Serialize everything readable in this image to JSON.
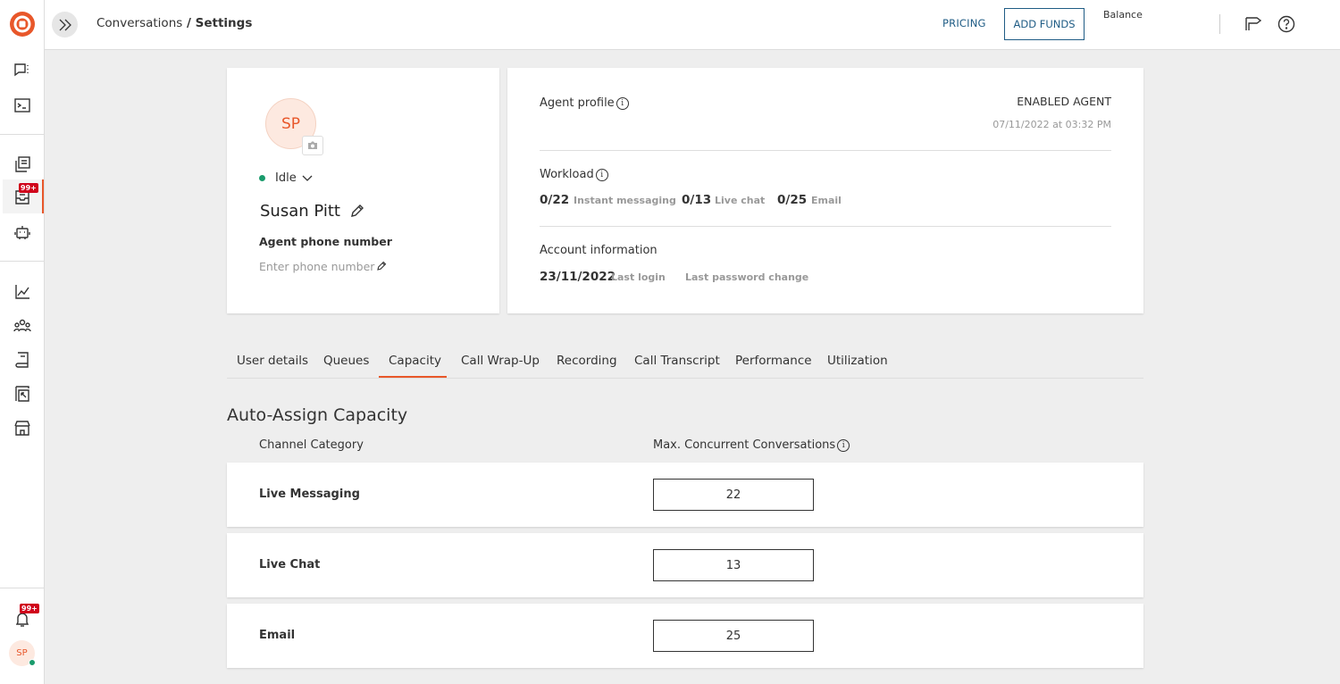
{
  "sidebar": {
    "notifications_badge": "99+",
    "inbox_badge": "99+",
    "avatar_initials": "SP"
  },
  "topbar": {
    "breadcrumb_parent": "Conversations",
    "breadcrumb_separator": " / ",
    "breadcrumb_current": "Settings",
    "pricing_label": "PRICING",
    "add_funds_label": "ADD FUNDS",
    "balance_label": "Balance"
  },
  "profile": {
    "initials": "SP",
    "status": "Idle",
    "name": "Susan Pitt",
    "phone_label": "Agent phone number",
    "phone_placeholder": "Enter phone number"
  },
  "agent": {
    "profile_label": "Agent profile",
    "enabled_label": "ENABLED AGENT",
    "enabled_date": "07/11/2022 at 03:32 PM",
    "workload_label": "Workload",
    "workload": [
      {
        "value": "0/22",
        "label": "Instant messaging"
      },
      {
        "value": "0/13",
        "label": "Live chat"
      },
      {
        "value": "0/25",
        "label": "Email"
      }
    ],
    "account_label": "Account information",
    "last_login_value": "23/11/2022",
    "last_login_label": "Last login",
    "last_password_label": "Last password change"
  },
  "tabs": [
    "User details",
    "Queues",
    "Capacity",
    "Call Wrap-Up",
    "Recording",
    "Call Transcript",
    "Performance",
    "Utilization"
  ],
  "active_tab": "Capacity",
  "capacity": {
    "title": "Auto-Assign Capacity",
    "col_channel": "Channel Category",
    "col_max": "Max. Concurrent Conversations",
    "rows": [
      {
        "label": "Live Messaging",
        "value": "22"
      },
      {
        "label": "Live Chat",
        "value": "13"
      },
      {
        "label": "Email",
        "value": "25"
      }
    ]
  },
  "colors": {
    "accent": "#e8572a",
    "link": "#1f5c85",
    "status_online": "#1a9b6c",
    "badge": "#d0021b"
  }
}
